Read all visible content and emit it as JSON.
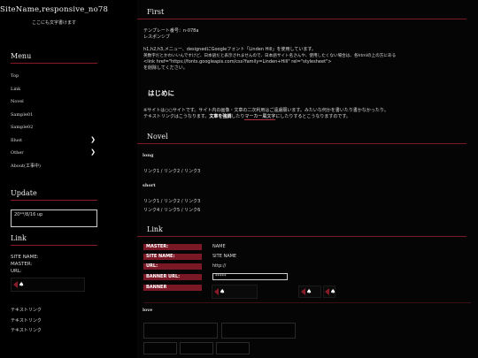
{
  "site": {
    "title": "SiteName,responsive_no78",
    "subtitle": "ここにも文字書けます"
  },
  "sidebar": {
    "menu_heading": "Menu",
    "menu_items": [
      {
        "label": "Top",
        "has_submenu": false
      },
      {
        "label": "Link",
        "has_submenu": false
      },
      {
        "label": "Novel",
        "has_submenu": false
      },
      {
        "label": "Sample01",
        "has_submenu": false
      },
      {
        "label": "Sample02",
        "has_submenu": false
      },
      {
        "label": "Illust",
        "has_submenu": true
      },
      {
        "label": "Other",
        "has_submenu": true
      },
      {
        "label": "About(工事中)",
        "has_submenu": false
      }
    ],
    "update_heading": "Update",
    "update_text": "20**/8/16 up",
    "link_heading": "Link",
    "link_info": [
      "SITE NAME:",
      "MASTER:",
      "URL:"
    ],
    "text_links": [
      "テキストリンク",
      "テキストリンク",
      "テキストリンク"
    ]
  },
  "main": {
    "first": {
      "heading": "First",
      "lines": [
        "テンプレート番号：n-078a",
        "レスポンシブ",
        "",
        "h1,h2,h3,メニュー、designedにGoogleフォント「Linden Hill」を使用しています。",
        "英数字だとかわいいんですけど、日本語だと表示されませんので、日本語サイト名さんや、使用したくない場合は、各htmlの上の方にある",
        "<link href=\"https://fonts.googleapis.com/css?family=Linden+Hill\" rel=\"stylesheet\">",
        "を削除してください。"
      ]
    },
    "hajimeni": {
      "heading": "はじめに",
      "line1": "※サイトは○○サイトです。サイト内の画像・文章の二次利用はご遠慮願います。みたいな何かを書いたり書かなかったり。",
      "line2_a": "テキストリンク",
      "line2_b": "はこうなります。",
      "line2_bold": "文章を強調",
      "line2_c": "したり",
      "line2_marker": "マーカー風文字",
      "line2_d": "にしたりするとこうなりますのです。"
    },
    "novel": {
      "heading": "Novel",
      "long_label": "long",
      "long_links": "リンク1 / リンク2 / リンク3",
      "short_label": "short",
      "short_links_1": "リンク1 / リンク2 / リンク3",
      "short_links_2": "リンク4 / リンク5 / リンク6"
    },
    "link": {
      "heading": "Link",
      "fields": [
        {
          "label": "MASTER:",
          "value": "NAME"
        },
        {
          "label": "SITE NAME:",
          "value": "SITE NAME"
        },
        {
          "label": "URL:",
          "value": "http://"
        },
        {
          "label": "BANNER URL:",
          "value": "*****"
        },
        {
          "label": "BANNER",
          "value": ""
        }
      ],
      "love_label": "love"
    }
  },
  "colors": {
    "background": "#000000",
    "accent": "#7a1826",
    "text": "#dddddd"
  }
}
